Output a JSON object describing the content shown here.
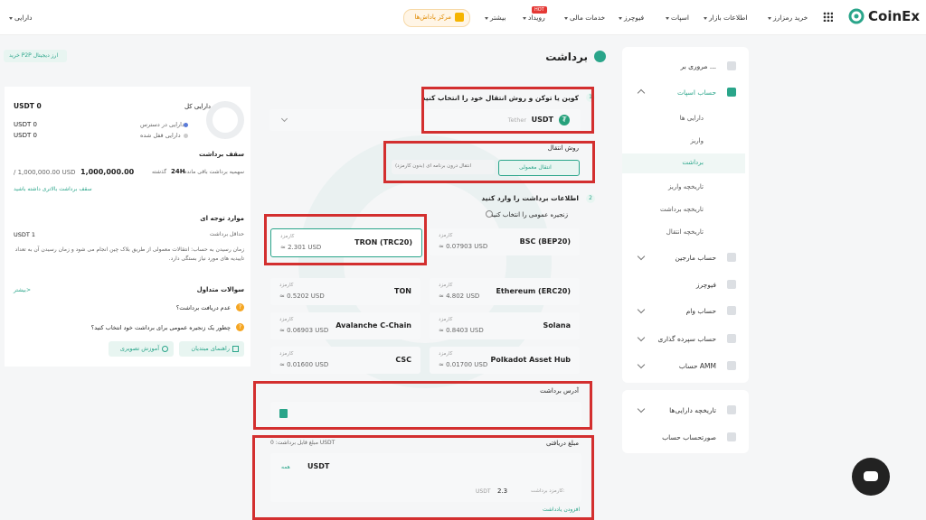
{
  "header": {
    "logo": "CoinEx",
    "nav": [
      {
        "label": "خرید رمزارز",
        "caret": true
      },
      {
        "label": "اطلاعات بازار",
        "caret": true
      },
      {
        "label": "اسپات",
        "caret": true
      },
      {
        "label": "فیوچرز",
        "caret": true
      },
      {
        "label": "خدمات مالی",
        "caret": true
      },
      {
        "label": "رویداد",
        "caret": true,
        "badge": "HOT"
      },
      {
        "label": "بیشتر",
        "caret": true
      }
    ],
    "promo_label": "مرکز پاداش‌ها",
    "assets_label": "دارایی"
  },
  "sidebar": {
    "items": [
      {
        "label": "مروری بر ...",
        "type": "item"
      },
      {
        "label": "حساب اسپات",
        "type": "item-active",
        "chevron": "up"
      },
      {
        "label": "دارایی ها",
        "type": "sub"
      },
      {
        "label": "واریز",
        "type": "sub"
      },
      {
        "label": "برداشت",
        "type": "sub-active"
      },
      {
        "label": "تاریخچه واریز",
        "type": "sub"
      },
      {
        "label": "تاریخچه برداشت",
        "type": "sub"
      },
      {
        "label": "تاریخچه انتقال",
        "type": "sub"
      },
      {
        "label": "حساب مارجین",
        "type": "item",
        "chevron": "down"
      },
      {
        "label": "فیوچرز",
        "type": "item"
      },
      {
        "label": "حساب وام",
        "type": "item",
        "chevron": "down"
      },
      {
        "label": "حساب سپرده گذاری",
        "type": "item",
        "chevron": "down"
      },
      {
        "label": "حساب AMM",
        "type": "item",
        "chevron": "down"
      }
    ],
    "items2": [
      {
        "label": "تاریخچه دارایی‌ها",
        "chevron": "down"
      },
      {
        "label": "صورتحساب حساب"
      }
    ]
  },
  "page": {
    "title": "برداشت",
    "p2p_button": "خرید P2P ارز دیجیتال"
  },
  "step1": {
    "num": "1",
    "title": "کوین یا توکن و روش انتقال خود را انتخاب کنید",
    "coin": "USDT",
    "coin_full": "Tether"
  },
  "transfer": {
    "title": "روش انتقال",
    "option_normal": "انتقال معمولی",
    "option_internal": "انتقال درون برنامه ای (بدون کارمزد)"
  },
  "step2": {
    "num": "2",
    "title": "اطلاعات برداشت را وارد کنید",
    "chain_prompt": "زنجیره عمومی را انتخاب کنید"
  },
  "networks": [
    {
      "name": "BSC (BEP20)",
      "fee_label": "کارمزد",
      "fee": "≈ 0.07903 USD"
    },
    {
      "name": "TRON (TRC20)",
      "fee_label": "کارمزد",
      "fee": "≈ 2.301 USD"
    },
    {
      "name": "Ethereum (ERC20)",
      "fee_label": "کارمزد",
      "fee": "≈ 4.802 USD"
    },
    {
      "name": "TON",
      "fee_label": "کارمزد",
      "fee": "≈ 0.5202 USD"
    },
    {
      "name": "Solana",
      "fee_label": "کارمزد",
      "fee": "≈ 0.8403 USD"
    },
    {
      "name": "Avalanche C-Chain",
      "fee_label": "کارمزد",
      "fee": "≈ 0.06903 USD"
    },
    {
      "name": "Polkadot Asset Hub",
      "fee_label": "کارمزد",
      "fee": "≈ 0.01700 USD"
    },
    {
      "name": "CSC",
      "fee_label": "کارمزد",
      "fee": "≈ 0.01600 USD"
    }
  ],
  "address": {
    "label": "آدرس برداشت"
  },
  "amount": {
    "label": "مبلغ دریافتی",
    "available": "مبلغ قابل برداشت: 0 USDT",
    "currency": "USDT",
    "all_button": "همه",
    "fee_label": "کارمزد برداشت:",
    "fee_value": "2.3",
    "fee_unit": "USDT",
    "insufficient": "افزودن یادداشت"
  },
  "summary": {
    "total_label": "دارایی کل",
    "total_value": "USDT 0",
    "available_label": "دارایی در دسترس",
    "available_value": "USDT 0",
    "frozen_label": "دارایی قفل شده",
    "frozen_value": "USDT 0",
    "limit_title": "سقف برداشت",
    "limit_label": "سهمیه برداشت باقی مانده",
    "limit_period": "24H",
    "limit_period_suffix": "گذشته",
    "limit_value": "1,000,000.00",
    "limit_total": "/ 1,000,000.00 USD",
    "limit_link": "سقف برداشت بالاتری داشته باشید",
    "notes_title": "موارد توجه ای",
    "min_label": "حداقل برداشت",
    "min_value": "USDT 1",
    "notes_text": "زمان رسیدن به حساب: انتقالات معمولی از طریق بلاک چین انجام می شود و زمان رسیدن آن به تعداد تاییدیه های مورد نیاز بستگی دارد.",
    "faq_title": "سوالات متداول",
    "faq_more": "بیشتر>",
    "faq": [
      "عدم دریافت برداشت؟",
      "چطور یک زنجیره عمومی برای برداشت خود انتخاب کنید؟"
    ],
    "guide_button": "راهنمای مبتدیان",
    "video_button": "آموزش تصویری"
  },
  "colors": {
    "accent": "#2aa58a",
    "highlight": "#d32f2f"
  }
}
